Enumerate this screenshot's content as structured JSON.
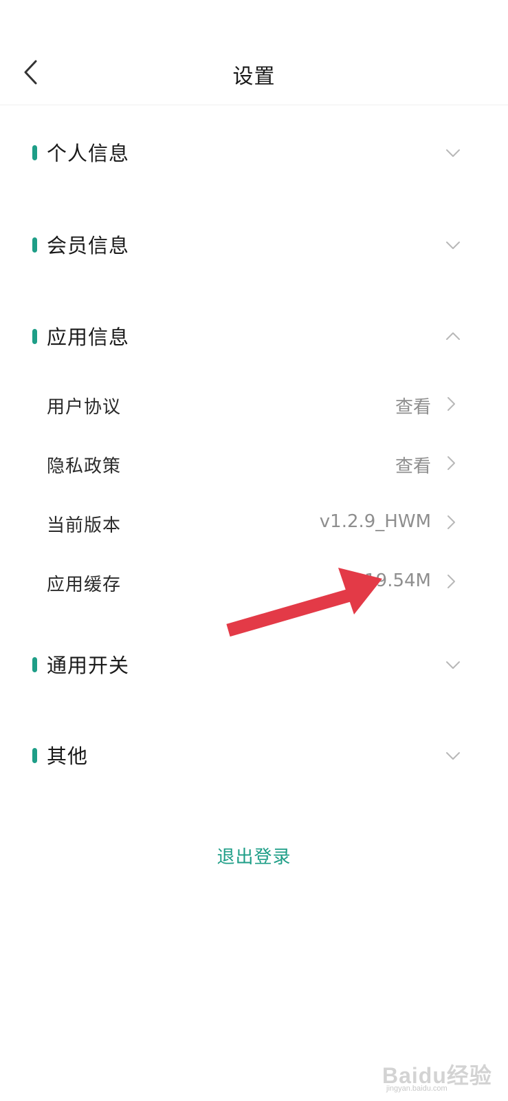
{
  "nav": {
    "title": "设置",
    "back_icon": "chevron-left-icon"
  },
  "colors": {
    "accent": "#1e9e87",
    "text": "#1a1a1a",
    "muted": "#8e8e8e",
    "chevron": "#b8b8b8",
    "arrow": "#e33a47"
  },
  "sections": [
    {
      "title": "个人信息",
      "expanded": false
    },
    {
      "title": "会员信息",
      "expanded": false
    },
    {
      "title": "应用信息",
      "expanded": true,
      "items": [
        {
          "label": "用户协议",
          "value": "查看"
        },
        {
          "label": "隐私政策",
          "value": "查看"
        },
        {
          "label": "当前版本",
          "value": "v1.2.9_HWM"
        },
        {
          "label": "应用缓存",
          "value": "19.54M"
        }
      ]
    },
    {
      "title": "通用开关",
      "expanded": false
    },
    {
      "title": "其他",
      "expanded": false
    }
  ],
  "logout_label": "退出登录",
  "watermark": {
    "brand": "Baidu经验",
    "sub": "jingyan.baidu.com"
  }
}
